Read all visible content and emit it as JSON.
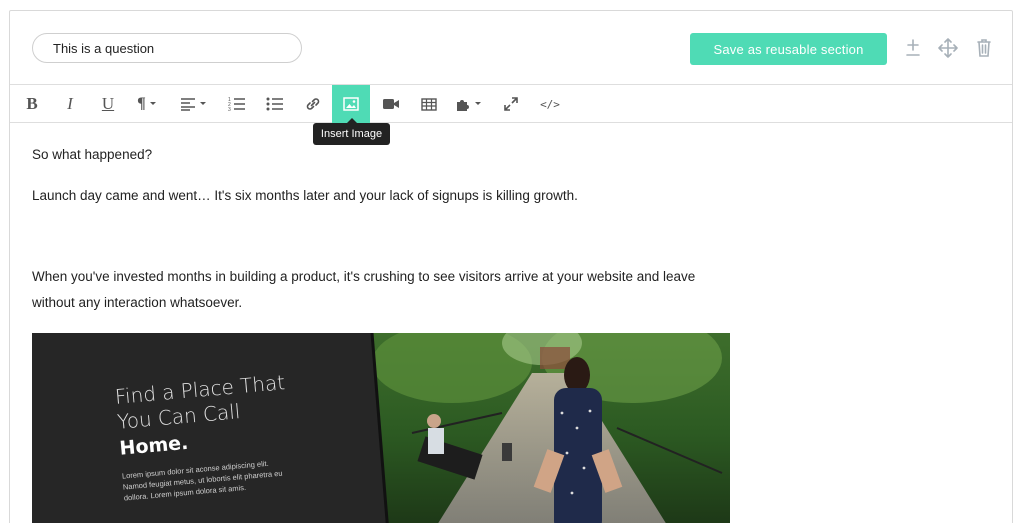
{
  "header": {
    "question_value": "This is a question",
    "save_label": "Save as reusable section",
    "icons": [
      "add-section-icon",
      "move-icon",
      "trash-icon"
    ]
  },
  "toolbar": {
    "items": [
      {
        "name": "bold",
        "glyph": "B"
      },
      {
        "name": "italic",
        "glyph": "I"
      },
      {
        "name": "underline",
        "glyph": "U"
      },
      {
        "name": "paragraph-format",
        "glyph": "¶"
      },
      {
        "name": "align"
      },
      {
        "name": "ordered-list"
      },
      {
        "name": "unordered-list"
      },
      {
        "name": "insert-link"
      },
      {
        "name": "insert-image",
        "active": true
      },
      {
        "name": "insert-video"
      },
      {
        "name": "insert-table"
      },
      {
        "name": "plugins"
      },
      {
        "name": "fullscreen"
      },
      {
        "name": "code-view",
        "glyph": "</>"
      }
    ],
    "tooltip": "Insert Image"
  },
  "content": {
    "p1": "So what happened?",
    "p2": "Launch day came and went… It's six months later and your lack of signups is killing growth.",
    "p3_line1": "When you've invested months in building a product, it's crushing to see visitors arrive at your website and leave",
    "p3_line2": "without any interaction whatsoever.",
    "image": {
      "headline_line1": "Find a Place That",
      "headline_line2": "You Can Call",
      "headline_home": "Home.",
      "lorem_line1": "Lorem ipsum dolor sit aconse adipiscing elit.",
      "lorem_line2": "Namod feugiat metus, ut lobortis elit pharetra eu",
      "lorem_line3": "dollora. Lorem ipsum dolora sit amis."
    }
  },
  "colors": {
    "accent": "#4fdbb5",
    "toolbar_icon": "#555555",
    "tooltip_bg": "#222222"
  }
}
